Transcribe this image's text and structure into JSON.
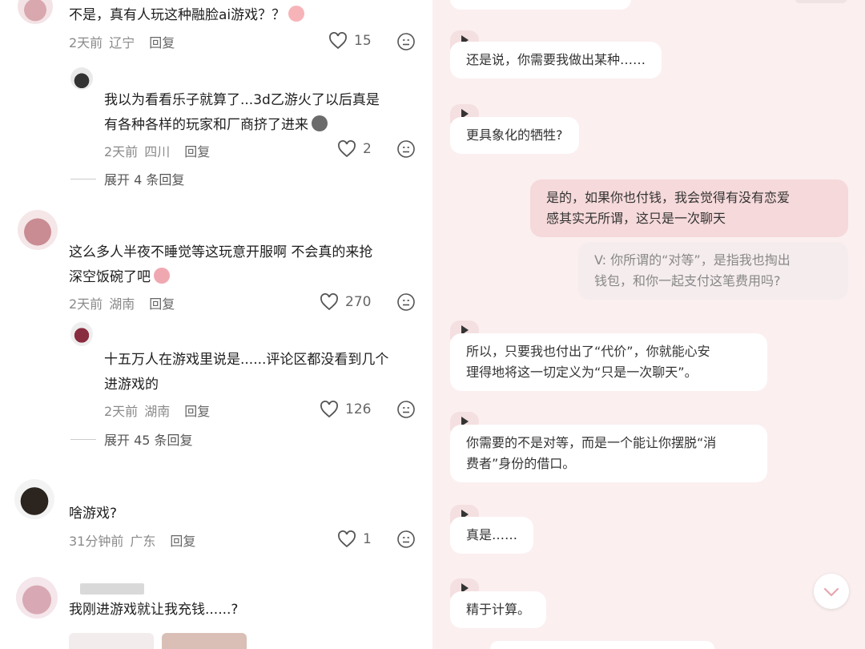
{
  "comments": [
    {
      "text": "不是，真有人玩这种融脸ai游戏？？",
      "time": "2天前",
      "loc": "辽宁",
      "reply": "回复",
      "likes": "15"
    },
    {
      "text_lines": [
        "我以为看看乐子就算了...3d乙游火了以后真是",
        "有各种各样的玩家和厂商挤了进来"
      ],
      "time": "2天前",
      "loc": "四川",
      "reply": "回复",
      "likes": "2",
      "expand": "展开 4 条回复"
    },
    {
      "text_lines": [
        "这么多人半夜不睡觉等这玩意开服啊 不会真的来抢",
        "深空饭碗了吧"
      ],
      "time": "2天前",
      "loc": "湖南",
      "reply": "回复",
      "likes": "270"
    },
    {
      "text_lines": [
        "十五万人在游戏里说是......评论区都没看到几个",
        "进游戏的"
      ],
      "time": "2天前",
      "loc": "湖南",
      "reply": "回复",
      "likes": "126",
      "expand": "展开 45 条回复"
    },
    {
      "text": "啥游戏?",
      "time": "31分钟前",
      "loc": "广东",
      "reply": "回复",
      "likes": "1"
    },
    {
      "text": "我刚进游戏就让我充钱......?"
    }
  ],
  "chat": {
    "m1": "还是说，你需要我做出某种……",
    "m2": "更具象化的牺牲?",
    "m3_lines": [
      "是的，如果你也付钱，我会觉得有没有恋爱",
      "感其实无所谓，这只是一次聊天"
    ],
    "m4_lines": [
      "V: 你所谓的“对等”，是指我也掏出",
      "钱包，和你一起支付这笔费用吗?"
    ],
    "m5_lines": [
      "所以，只要我也付出了“代价”，你就能心安",
      "理得地将这一切定义为“只是一次聊天”。"
    ],
    "m6_lines": [
      "你需要的不是对等，而是一个能让你摆脱“消",
      "费者”身份的借口。"
    ],
    "m7": "真是……",
    "m8": "精于计算。"
  },
  "colors": {
    "bg_right": "#fbeff0",
    "bubble_me": "#f6d9da",
    "bubble_ai": "#ffffff"
  }
}
